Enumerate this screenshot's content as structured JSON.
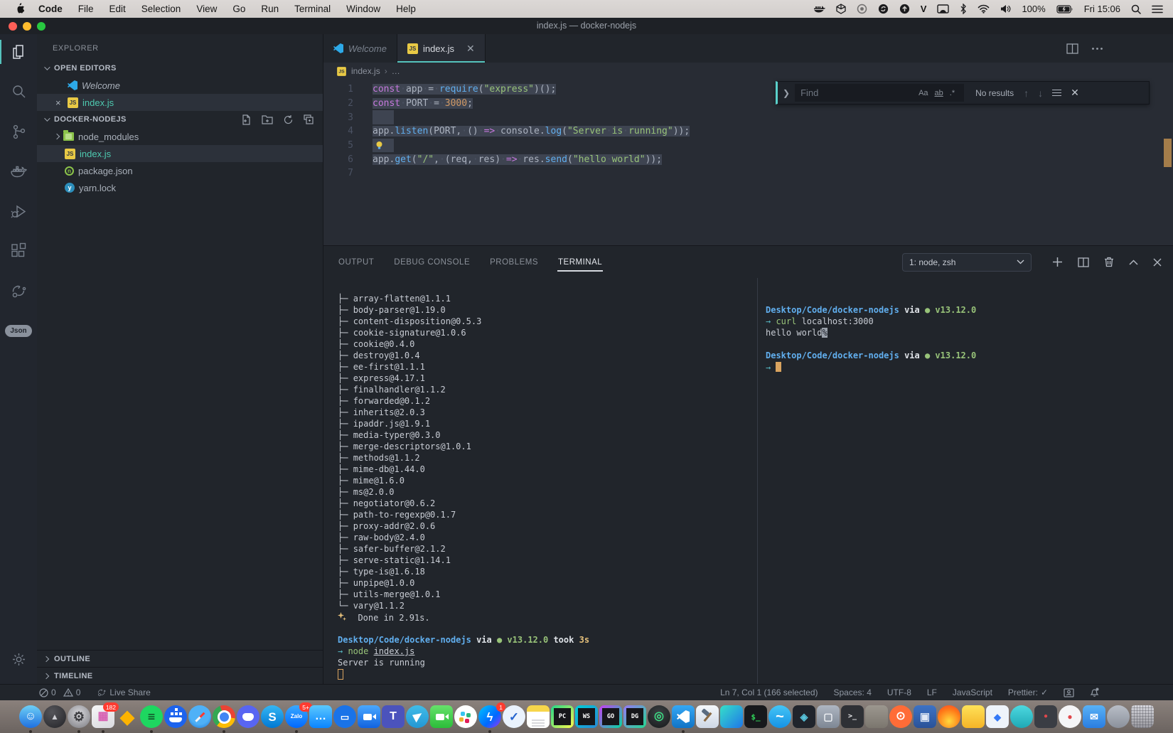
{
  "menubar": {
    "app_name": "Code",
    "items": [
      "File",
      "Edit",
      "Selection",
      "View",
      "Go",
      "Run",
      "Terminal",
      "Window",
      "Help"
    ],
    "battery": "100%",
    "clock": "Fri 15:06",
    "v_icon_label": "V"
  },
  "titlebar": {
    "title": "index.js — docker-nodejs"
  },
  "activitybar": {
    "json_label": "Json"
  },
  "sidebar": {
    "title": "EXPLORER",
    "open_editors": {
      "header": "OPEN EDITORS",
      "items": [
        {
          "label": "Welcome",
          "icon": "vscode",
          "italic": true,
          "closable": false,
          "selected": false
        },
        {
          "label": "index.js",
          "icon": "js",
          "italic": false,
          "closable": true,
          "selected": true
        }
      ]
    },
    "folder": {
      "header": "DOCKER-NODEJS",
      "items": [
        {
          "label": "node_modules",
          "icon": "folder",
          "chevron": true
        },
        {
          "label": "index.js",
          "icon": "js",
          "selected": true
        },
        {
          "label": "package.json",
          "icon": "npm"
        },
        {
          "label": "yarn.lock",
          "icon": "yarn"
        }
      ]
    },
    "outline": "OUTLINE",
    "timeline": "TIMELINE"
  },
  "editor": {
    "tabs": [
      {
        "label": "Welcome",
        "icon": "vscode",
        "active": false,
        "italic": true,
        "closable": false
      },
      {
        "label": "index.js",
        "icon": "js",
        "active": true,
        "italic": false,
        "closable": true
      }
    ],
    "breadcrumb": {
      "file": "index.js",
      "sep": "›",
      "more": "…"
    },
    "find": {
      "placeholder": "Find",
      "aa": "Aa",
      "ab": "ab",
      "regex": ".*",
      "results": "No results"
    },
    "code": [
      {
        "n": "1",
        "sel": true,
        "tokens": [
          [
            "k",
            "const"
          ],
          [
            "w",
            "·"
          ],
          [
            "p",
            "app"
          ],
          [
            "w",
            "·"
          ],
          [
            "p",
            "="
          ],
          [
            "w",
            "·"
          ],
          [
            "f",
            "require"
          ],
          [
            "p",
            "("
          ],
          [
            "s",
            "\"express\""
          ],
          [
            "p",
            ")();"
          ]
        ]
      },
      {
        "n": "2",
        "sel": true,
        "tokens": [
          [
            "k",
            "const"
          ],
          [
            "w",
            "·"
          ],
          [
            "p",
            "PORT"
          ],
          [
            "w",
            "·"
          ],
          [
            "p",
            "="
          ],
          [
            "w",
            "·"
          ],
          [
            "n",
            "3000"
          ],
          [
            "p",
            ";"
          ]
        ]
      },
      {
        "n": "3",
        "sel": true,
        "tokens": []
      },
      {
        "n": "4",
        "sel": true,
        "tokens": [
          [
            "p",
            "app"
          ],
          [
            "p",
            "."
          ],
          [
            "f",
            "listen"
          ],
          [
            "p",
            "("
          ],
          [
            "p",
            "PORT,"
          ],
          [
            "w",
            "·"
          ],
          [
            "p",
            "()"
          ],
          [
            "w",
            "·"
          ],
          [
            "k",
            "=>"
          ],
          [
            "w",
            "·"
          ],
          [
            "p",
            "console"
          ],
          [
            "p",
            "."
          ],
          [
            "f",
            "log"
          ],
          [
            "p",
            "("
          ],
          [
            "s",
            "\"Server"
          ],
          [
            "w",
            "·"
          ],
          [
            "s",
            "is"
          ],
          [
            "w",
            "·"
          ],
          [
            "s",
            "running\""
          ],
          [
            "p",
            "));"
          ]
        ]
      },
      {
        "n": "5",
        "sel": true,
        "bulb": true,
        "tokens": []
      },
      {
        "n": "6",
        "sel": true,
        "tokens": [
          [
            "p",
            "app"
          ],
          [
            "p",
            "."
          ],
          [
            "f",
            "get"
          ],
          [
            "p",
            "("
          ],
          [
            "s",
            "\"/\""
          ],
          [
            "p",
            ","
          ],
          [
            "w",
            "·"
          ],
          [
            "p",
            "(req,"
          ],
          [
            "w",
            "·"
          ],
          [
            "p",
            "res)"
          ],
          [
            "w",
            "·"
          ],
          [
            "k",
            "=>"
          ],
          [
            "w",
            "·"
          ],
          [
            "p",
            "res"
          ],
          [
            "p",
            "."
          ],
          [
            "f",
            "send"
          ],
          [
            "p",
            "("
          ],
          [
            "s",
            "\"hello"
          ],
          [
            "w",
            "·"
          ],
          [
            "s",
            "world\""
          ],
          [
            "p",
            "));"
          ]
        ]
      },
      {
        "n": "7",
        "sel": false,
        "tokens": []
      }
    ]
  },
  "panel": {
    "tabs": [
      {
        "label": "OUTPUT",
        "active": false
      },
      {
        "label": "DEBUG CONSOLE",
        "active": false
      },
      {
        "label": "PROBLEMS",
        "active": false
      },
      {
        "label": "TERMINAL",
        "active": true
      }
    ],
    "terminal_select": "1: node, zsh",
    "tree_mid": "├─ ",
    "tree_end": "└─ ",
    "left": {
      "packages": [
        "array-flatten@1.1.1",
        "body-parser@1.19.0",
        "content-disposition@0.5.3",
        "cookie-signature@1.0.6",
        "cookie@0.4.0",
        "destroy@1.0.4",
        "ee-first@1.1.1",
        "express@4.17.1",
        "finalhandler@1.1.2",
        "forwarded@0.1.2",
        "inherits@2.0.3",
        "ipaddr.js@1.9.1",
        "media-typer@0.3.0",
        "merge-descriptors@1.0.1",
        "methods@1.1.2",
        "mime-db@1.44.0",
        "mime@1.6.0",
        "ms@2.0.0",
        "negotiator@0.6.2",
        "path-to-regexp@0.1.7",
        "proxy-addr@2.0.6",
        "raw-body@2.4.0",
        "safer-buffer@2.1.2",
        "serve-static@1.14.1",
        "type-is@1.6.18",
        "unpipe@1.0.0",
        "utils-merge@1.0.1",
        "vary@1.1.2"
      ],
      "done": "Done in 2.91s.",
      "lines": [
        [],
        [
          [
            "cyb",
            "Desktop/Code/docker-nodejs"
          ],
          [
            "wb",
            " via "
          ],
          [
            "grb",
            "●"
          ],
          [
            "grb",
            " v13.12.0"
          ],
          [
            "wb",
            " took "
          ],
          [
            "yeb",
            "3s"
          ]
        ],
        [
          [
            "arr",
            "→ "
          ],
          [
            "grn",
            "node "
          ],
          [
            "und",
            "index.js"
          ]
        ],
        [
          [
            "pl",
            "Server is running"
          ]
        ],
        [
          [
            "cursor-outline",
            ""
          ]
        ]
      ]
    },
    "right": {
      "lines": [
        [],
        [
          [
            "cyb",
            "Desktop/Code/docker-nodejs"
          ],
          [
            "wb",
            " via "
          ],
          [
            "grb",
            "●"
          ],
          [
            "grb",
            " v13.12.0"
          ]
        ],
        [
          [
            "arr",
            "→ "
          ],
          [
            "grn",
            "curl "
          ],
          [
            "pl",
            "localhost:3000"
          ]
        ],
        [
          [
            "pl",
            "hello world"
          ],
          [
            "inv",
            "%"
          ]
        ],
        [],
        [
          [
            "cyb",
            "Desktop/Code/docker-nodejs"
          ],
          [
            "wb",
            " via "
          ],
          [
            "grb",
            "●"
          ],
          [
            "grb",
            " v13.12.0"
          ]
        ],
        [
          [
            "arr",
            "→ "
          ],
          [
            "cursor-block",
            ""
          ]
        ]
      ]
    }
  },
  "statusbar": {
    "errors": "0",
    "warnings": "0",
    "live_share": "Live Share",
    "position": "Ln 7, Col 1 (166 selected)",
    "indent": "Spaces: 4",
    "encoding": "UTF-8",
    "eol": "LF",
    "language": "JavaScript",
    "formatter": "Prettier:",
    "formatter_check": "✓"
  },
  "dock": {
    "items": [
      {
        "name": "finder",
        "shape": "c",
        "bg": "linear-gradient(180deg,#6ecff6,#1e6fe0)",
        "t": "☺",
        "tc": "#ffffff",
        "fs": 16,
        "run": true
      },
      {
        "name": "launchpad",
        "shape": "c",
        "bg": "radial-gradient(circle at 38% 30%,#55555a,#232327)",
        "t": "▲",
        "tc": "#cfcfd4",
        "fs": 12
      },
      {
        "name": "system-preferences",
        "shape": "c",
        "bg": "radial-gradient(circle at 50% 38%,#d8d8dc,#7a7a80)",
        "t": "⚙",
        "tc": "#3a3a3e",
        "fs": 18,
        "run": true
      },
      {
        "name": "photos",
        "shape": "r",
        "bg": "linear-gradient(160deg,#f7f7f7,#d9d9de)",
        "t": "▦",
        "tc": "#d65db1",
        "fs": 16,
        "badge": "182",
        "run": true
      },
      {
        "name": "sketch",
        "shape": "r",
        "bg": "transparent",
        "t": "◆",
        "tc": "#fdb300",
        "fs": 26
      },
      {
        "name": "spotify",
        "shape": "c",
        "bg": "#1ed760",
        "t": "≡",
        "tc": "#11331c",
        "fs": 18,
        "run": true
      },
      {
        "name": "docker",
        "shape": "c",
        "bg": "#1d63ed",
        "cls": "ic-docker"
      },
      {
        "name": "safari",
        "shape": "c",
        "cls": "ic-safari"
      },
      {
        "name": "chrome",
        "shape": "c",
        "cls": "ic-chrome",
        "run": true
      },
      {
        "name": "discord",
        "shape": "c",
        "bg": "#5865f2",
        "cls": "ic-discord"
      },
      {
        "name": "skype",
        "shape": "c",
        "bg": "linear-gradient(180deg,#35b6f2,#0078d4)",
        "t": "S",
        "tc": "#ffffff",
        "fs": 17
      },
      {
        "name": "zalo",
        "shape": "c",
        "bg": "linear-gradient(180deg,#39a9ff,#0068ff)",
        "t": "Zalo",
        "tc": "#ffffff",
        "fs": 8,
        "badge": "5+",
        "run": true
      },
      {
        "name": "messages",
        "shape": "r",
        "bg": "linear-gradient(180deg,#5bc9ff,#0a84ff)",
        "t": "…",
        "tc": "#ffffff",
        "fs": 16
      },
      {
        "name": "google-messages",
        "shape": "c",
        "bg": "#1a73e8",
        "t": "▭",
        "tc": "#ffffff",
        "fs": 13
      },
      {
        "name": "video-call",
        "shape": "r",
        "bg": "linear-gradient(180deg,#4aa8ff,#1263e0)",
        "cls": "ic-cam"
      },
      {
        "name": "teams",
        "shape": "r",
        "bg": "#4b53bc",
        "t": "T",
        "tc": "#ffffff",
        "fs": 16
      },
      {
        "name": "telegram",
        "shape": "c",
        "bg": "linear-gradient(180deg,#41bce7,#2397d4)",
        "cls": "ic-plane"
      },
      {
        "name": "facetime",
        "shape": "r",
        "bg": "linear-gradient(180deg,#67e26b,#2bbd3a)",
        "cls": "ic-cam"
      },
      {
        "name": "slack",
        "shape": "c",
        "bg": "#ffffff",
        "cls": "ic-slack"
      },
      {
        "name": "messenger",
        "shape": "c",
        "bg": "linear-gradient(135deg,#00c6ff,#0068ff 60%,#a334fa)",
        "t": "ϟ",
        "tc": "#ffffff",
        "fs": 17,
        "badge": "1",
        "run": true
      },
      {
        "name": "ms-todo",
        "shape": "c",
        "bg": "#eaf2fd",
        "t": "✓",
        "tc": "#2564cf",
        "fs": 17
      },
      {
        "name": "notes",
        "shape": "r",
        "cls": "ic-notes"
      },
      {
        "name": "pycharm",
        "shape": "r",
        "bg": "linear-gradient(135deg,#21d789,#fcf84a)",
        "cls": "ic-jb",
        "t": "PC"
      },
      {
        "name": "webstorm",
        "shape": "r",
        "bg": "linear-gradient(135deg,#00cdd7,#2888d4)",
        "cls": "ic-jb",
        "t": "WS"
      },
      {
        "name": "goland",
        "shape": "r",
        "bg": "linear-gradient(135deg,#ca3bf5,#00d8a0)",
        "cls": "ic-jb",
        "t": "GO"
      },
      {
        "name": "datagrip",
        "shape": "r",
        "bg": "linear-gradient(135deg,#9775f8,#22d88f)",
        "cls": "ic-jb",
        "t": "DG"
      },
      {
        "name": "android-studio",
        "shape": "c",
        "bg": "radial-gradient(circle at 50% 35%,#3b4043,#17191b)",
        "t": "◎",
        "tc": "#3ddc84",
        "fs": 16
      },
      {
        "name": "vscode",
        "shape": "r",
        "bg": "linear-gradient(180deg,#35a8f5,#1173c5)",
        "cls": "ic-vscode",
        "run": true
      },
      {
        "name": "xcode",
        "shape": "r",
        "bg": "linear-gradient(180deg,#f4f7fb,#cfd8e6)",
        "cls": "ic-hammer"
      },
      {
        "name": "gradient-app",
        "shape": "r",
        "bg": "linear-gradient(135deg,#35e0c9,#1f76e8)"
      },
      {
        "name": "terminal",
        "shape": "r",
        "bg": "#17181c",
        "t": "$_",
        "tc": "#30d158",
        "fs": 11,
        "mono": true
      },
      {
        "name": "swift-app",
        "shape": "c",
        "bg": "linear-gradient(180deg,#45c5f5,#1592e6)",
        "t": "~",
        "tc": "#ffffff",
        "fs": 20
      },
      {
        "name": "dark-app",
        "shape": "r",
        "bg": "#20242c",
        "t": "◈",
        "tc": "#58c4dc",
        "fs": 14
      },
      {
        "name": "window-app",
        "shape": "r",
        "bg": "linear-gradient(180deg,#aeb6c2,#7e8794)",
        "t": "▢",
        "tc": "#f2f4f7",
        "fs": 14
      },
      {
        "name": "console-app",
        "shape": "r",
        "bg": "#2e3035",
        "t": ">_",
        "tc": "#e8e8ea",
        "fs": 10,
        "mono": true
      },
      {
        "name": "gray-app",
        "shape": "r",
        "bg": "linear-gradient(180deg,#9c978f,#7b766e)"
      },
      {
        "name": "postman",
        "shape": "c",
        "bg": "#ff6c37",
        "t": "⊙",
        "tc": "#ffffff",
        "fs": 16
      },
      {
        "name": "virtualbox",
        "shape": "r",
        "bg": "linear-gradient(180deg,#3d73c5,#2a5298)",
        "t": "▣",
        "tc": "#dfe8f5",
        "fs": 15
      },
      {
        "name": "flame-app",
        "shape": "c",
        "bg": "radial-gradient(circle at 50% 70%,#ffd93d,#ff7a18 60%,#f5422b)"
      },
      {
        "name": "yellow-app",
        "shape": "r",
        "bg": "linear-gradient(180deg,#ffe259,#f5b427)"
      },
      {
        "name": "docs-app",
        "shape": "r",
        "bg": "#eef3fa",
        "t": "◆",
        "tc": "#3478f6",
        "fs": 13
      },
      {
        "name": "teal-app",
        "shape": "c",
        "bg": "linear-gradient(180deg,#4dd9e0,#1fa8b5)"
      },
      {
        "name": "dim-app",
        "shape": "r",
        "bg": "#3a3d44",
        "t": "●",
        "tc": "#e0474c",
        "fs": 10
      },
      {
        "name": "white-red-app",
        "shape": "c",
        "bg": "#f5f5f7",
        "t": "●",
        "tc": "#e0474c",
        "fs": 12
      },
      {
        "name": "mail-app",
        "shape": "r",
        "bg": "linear-gradient(180deg,#59b2f6,#2a7de1)",
        "t": "✉",
        "tc": "#ffffff",
        "fs": 14
      },
      {
        "name": "utility-app",
        "shape": "c",
        "bg": "linear-gradient(180deg,#b9bec7,#8b919c)"
      },
      {
        "name": "trash",
        "shape": "r",
        "cls": "ic-trash"
      }
    ]
  }
}
